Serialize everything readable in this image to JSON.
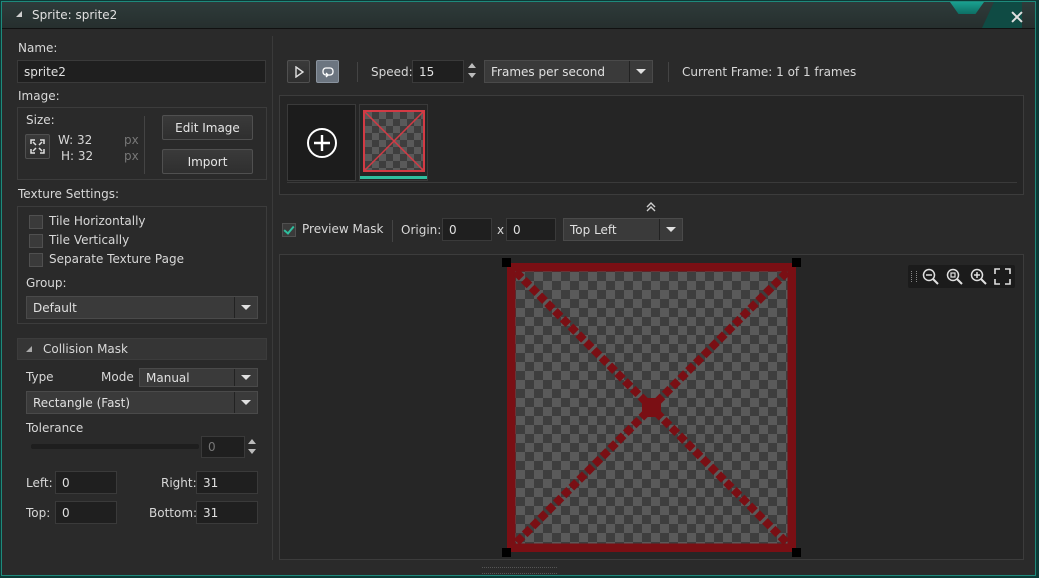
{
  "window": {
    "title": "Sprite: sprite2"
  },
  "left": {
    "name_label": "Name:",
    "name_value": "sprite2",
    "image_label": "Image:",
    "size_label": "Size:",
    "width_text": "W: 32",
    "height_text": "H: 32",
    "unit_px": "px",
    "edit_image": "Edit Image",
    "import": "Import",
    "texture_label": "Texture Settings:",
    "tile_h": "Tile Horizontally",
    "tile_v": "Tile Vertically",
    "separate_page": "Separate Texture Page",
    "group_label": "Group:",
    "group_value": "Default",
    "collision_header": "Collision Mask",
    "type_label": "Type",
    "mode_label": "Mode",
    "mode_value": "Manual",
    "shape_value": "Rectangle (Fast)",
    "tolerance_label": "Tolerance",
    "tolerance_value": "0",
    "left_label": "Left:",
    "left_value": "0",
    "right_label": "Right:",
    "right_value": "31",
    "top_label": "Top:",
    "top_value": "0",
    "bottom_label": "Bottom:",
    "bottom_value": "31"
  },
  "toolbar": {
    "speed_label": "Speed:",
    "speed_value": "15",
    "speed_unit": "Frames per second",
    "current_frame": "Current Frame: 1 of 1 frames"
  },
  "preview": {
    "preview_mask_label": "Preview Mask",
    "origin_label": "Origin:",
    "origin_x": "0",
    "origin_sep": "x",
    "origin_y": "0",
    "origin_preset": "Top Left"
  },
  "colors": {
    "accent": "#1e8a7c",
    "mask_red": "#7a0f14",
    "frame_red": "#d33a44"
  },
  "icons": [
    "play-icon",
    "loop-icon",
    "add-frame-icon",
    "zoom-out-icon",
    "zoom-reset-icon",
    "zoom-in-icon",
    "fit-icon",
    "collapse-icon",
    "resize-icon",
    "close-icon"
  ]
}
